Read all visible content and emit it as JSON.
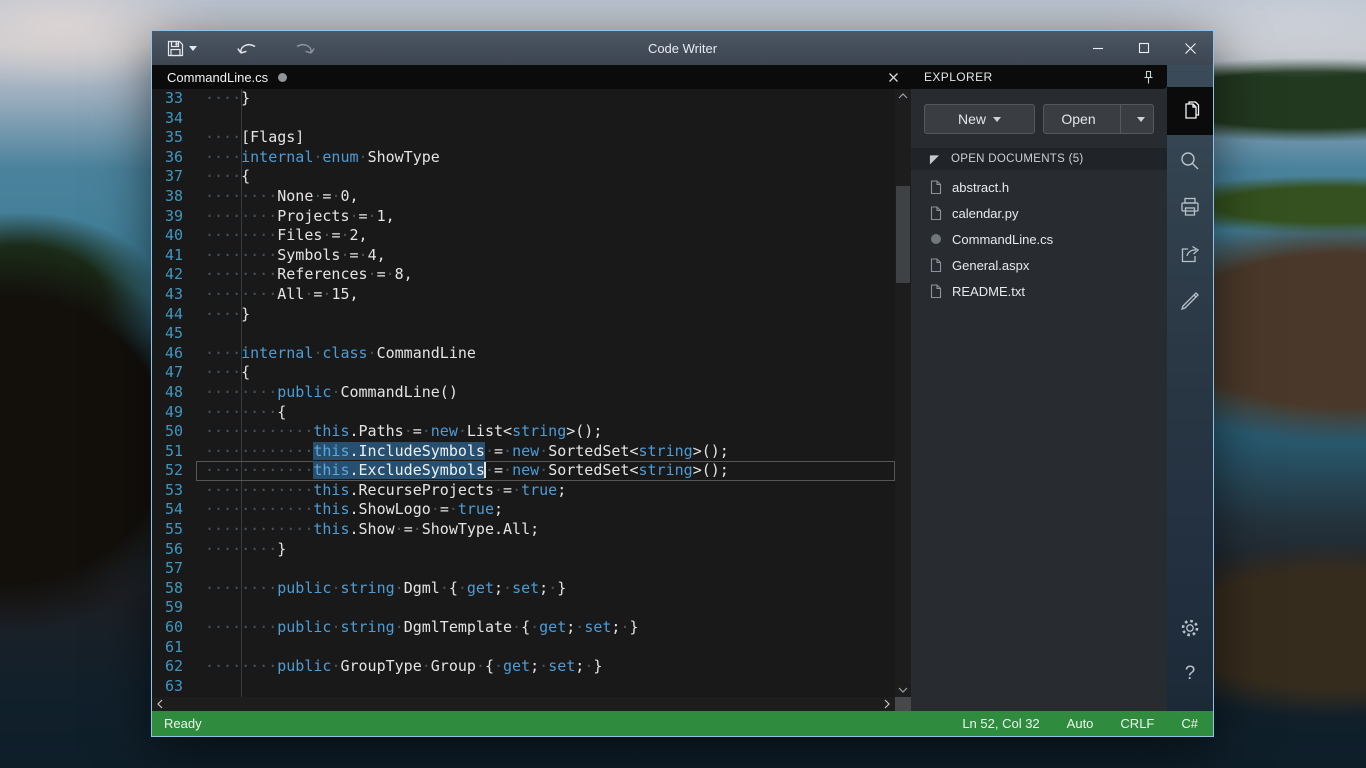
{
  "window": {
    "title": "Code Writer",
    "toolbar": {
      "save_icon": "save-icon",
      "save_dropdown_icon": "chevron-down-icon",
      "undo_icon": "undo-icon",
      "redo_icon": "redo-icon",
      "redo_disabled": true
    },
    "controls": {
      "minimize": "minimize-icon",
      "maximize": "maximize-icon",
      "close": "close-icon"
    }
  },
  "tab": {
    "name": "CommandLine.cs",
    "modified": true
  },
  "editor": {
    "cursor": {
      "line": 52,
      "col": 32
    },
    "highlighted_symbol": "ExcludeSymbols",
    "lines": [
      {
        "n": 33,
        "s": [
          [
            "w",
            "····"
          ],
          [
            "p",
            "}"
          ]
        ]
      },
      {
        "n": 34,
        "s": []
      },
      {
        "n": 35,
        "s": [
          [
            "w",
            "····"
          ],
          [
            "p",
            "[Flags]"
          ]
        ]
      },
      {
        "n": 36,
        "s": [
          [
            "w",
            "····"
          ],
          [
            "k",
            "internal"
          ],
          [
            "w",
            "·"
          ],
          [
            "k",
            "enum"
          ],
          [
            "w",
            "·"
          ],
          [
            "p",
            "ShowType"
          ]
        ]
      },
      {
        "n": 37,
        "s": [
          [
            "w",
            "····"
          ],
          [
            "p",
            "{"
          ]
        ]
      },
      {
        "n": 38,
        "s": [
          [
            "w",
            "········"
          ],
          [
            "p",
            "None"
          ],
          [
            "w",
            "·"
          ],
          [
            "p",
            "="
          ],
          [
            "w",
            "·"
          ],
          [
            "p",
            "0,"
          ]
        ]
      },
      {
        "n": 39,
        "s": [
          [
            "w",
            "········"
          ],
          [
            "p",
            "Projects"
          ],
          [
            "w",
            "·"
          ],
          [
            "p",
            "="
          ],
          [
            "w",
            "·"
          ],
          [
            "p",
            "1,"
          ]
        ]
      },
      {
        "n": 40,
        "s": [
          [
            "w",
            "········"
          ],
          [
            "p",
            "Files"
          ],
          [
            "w",
            "·"
          ],
          [
            "p",
            "="
          ],
          [
            "w",
            "·"
          ],
          [
            "p",
            "2,"
          ]
        ]
      },
      {
        "n": 41,
        "s": [
          [
            "w",
            "········"
          ],
          [
            "p",
            "Symbols"
          ],
          [
            "w",
            "·"
          ],
          [
            "p",
            "="
          ],
          [
            "w",
            "·"
          ],
          [
            "p",
            "4,"
          ]
        ]
      },
      {
        "n": 42,
        "s": [
          [
            "w",
            "········"
          ],
          [
            "p",
            "References"
          ],
          [
            "w",
            "·"
          ],
          [
            "p",
            "="
          ],
          [
            "w",
            "·"
          ],
          [
            "p",
            "8,"
          ]
        ]
      },
      {
        "n": 43,
        "s": [
          [
            "w",
            "········"
          ],
          [
            "p",
            "All"
          ],
          [
            "w",
            "·"
          ],
          [
            "p",
            "="
          ],
          [
            "w",
            "·"
          ],
          [
            "p",
            "15,"
          ]
        ]
      },
      {
        "n": 44,
        "s": [
          [
            "w",
            "····"
          ],
          [
            "p",
            "}"
          ]
        ]
      },
      {
        "n": 45,
        "s": []
      },
      {
        "n": 46,
        "s": [
          [
            "w",
            "····"
          ],
          [
            "k",
            "internal"
          ],
          [
            "w",
            "·"
          ],
          [
            "k",
            "class"
          ],
          [
            "w",
            "·"
          ],
          [
            "p",
            "CommandLine"
          ]
        ]
      },
      {
        "n": 47,
        "s": [
          [
            "w",
            "····"
          ],
          [
            "p",
            "{"
          ]
        ]
      },
      {
        "n": 48,
        "s": [
          [
            "w",
            "········"
          ],
          [
            "k",
            "public"
          ],
          [
            "w",
            "·"
          ],
          [
            "p",
            "CommandLine()"
          ]
        ]
      },
      {
        "n": 49,
        "s": [
          [
            "w",
            "········"
          ],
          [
            "p",
            "{"
          ]
        ]
      },
      {
        "n": 50,
        "s": [
          [
            "w",
            "············"
          ],
          [
            "k",
            "this"
          ],
          [
            "p",
            ".Paths"
          ],
          [
            "w",
            "·"
          ],
          [
            "p",
            "="
          ],
          [
            "w",
            "·"
          ],
          [
            "k",
            "new"
          ],
          [
            "w",
            "·"
          ],
          [
            "p",
            "List<"
          ],
          [
            "k",
            "string"
          ],
          [
            "p",
            ">();"
          ]
        ]
      },
      {
        "n": 51,
        "s": [
          [
            "w",
            "············"
          ],
          [
            "sk",
            "this"
          ],
          [
            "sp",
            ".IncludeSymbols"
          ],
          [
            "w",
            "·"
          ],
          [
            "p",
            "="
          ],
          [
            "w",
            "·"
          ],
          [
            "k",
            "new"
          ],
          [
            "w",
            "·"
          ],
          [
            "p",
            "SortedSet<"
          ],
          [
            "k",
            "string"
          ],
          [
            "p",
            ">();"
          ]
        ]
      },
      {
        "n": 52,
        "cur": true,
        "s": [
          [
            "w",
            "············"
          ],
          [
            "sk",
            "this"
          ],
          [
            "sp",
            ".ExcludeSymbols"
          ],
          [
            "c",
            ""
          ],
          [
            "w",
            "·"
          ],
          [
            "p",
            "="
          ],
          [
            "w",
            "·"
          ],
          [
            "k",
            "new"
          ],
          [
            "w",
            "·"
          ],
          [
            "p",
            "SortedSet<"
          ],
          [
            "k",
            "string"
          ],
          [
            "p",
            ">();"
          ]
        ]
      },
      {
        "n": 53,
        "s": [
          [
            "w",
            "············"
          ],
          [
            "k",
            "this"
          ],
          [
            "p",
            ".RecurseProjects"
          ],
          [
            "w",
            "·"
          ],
          [
            "p",
            "="
          ],
          [
            "w",
            "·"
          ],
          [
            "k",
            "true"
          ],
          [
            "p",
            ";"
          ]
        ]
      },
      {
        "n": 54,
        "s": [
          [
            "w",
            "············"
          ],
          [
            "k",
            "this"
          ],
          [
            "p",
            ".ShowLogo"
          ],
          [
            "w",
            "·"
          ],
          [
            "p",
            "="
          ],
          [
            "w",
            "·"
          ],
          [
            "k",
            "true"
          ],
          [
            "p",
            ";"
          ]
        ]
      },
      {
        "n": 55,
        "s": [
          [
            "w",
            "············"
          ],
          [
            "k",
            "this"
          ],
          [
            "p",
            ".Show"
          ],
          [
            "w",
            "·"
          ],
          [
            "p",
            "="
          ],
          [
            "w",
            "·"
          ],
          [
            "p",
            "ShowType.All;"
          ]
        ]
      },
      {
        "n": 56,
        "s": [
          [
            "w",
            "········"
          ],
          [
            "p",
            "}"
          ]
        ]
      },
      {
        "n": 57,
        "s": []
      },
      {
        "n": 58,
        "s": [
          [
            "w",
            "········"
          ],
          [
            "k",
            "public"
          ],
          [
            "w",
            "·"
          ],
          [
            "k",
            "string"
          ],
          [
            "w",
            "·"
          ],
          [
            "p",
            "Dgml"
          ],
          [
            "w",
            "·"
          ],
          [
            "p",
            "{"
          ],
          [
            "w",
            "·"
          ],
          [
            "k",
            "get"
          ],
          [
            "p",
            ";"
          ],
          [
            "w",
            "·"
          ],
          [
            "k",
            "set"
          ],
          [
            "p",
            ";"
          ],
          [
            "w",
            "·"
          ],
          [
            "p",
            "}"
          ]
        ]
      },
      {
        "n": 59,
        "s": []
      },
      {
        "n": 60,
        "s": [
          [
            "w",
            "········"
          ],
          [
            "k",
            "public"
          ],
          [
            "w",
            "·"
          ],
          [
            "k",
            "string"
          ],
          [
            "w",
            "·"
          ],
          [
            "p",
            "DgmlTemplate"
          ],
          [
            "w",
            "·"
          ],
          [
            "p",
            "{"
          ],
          [
            "w",
            "·"
          ],
          [
            "k",
            "get"
          ],
          [
            "p",
            ";"
          ],
          [
            "w",
            "·"
          ],
          [
            "k",
            "set"
          ],
          [
            "p",
            ";"
          ],
          [
            "w",
            "·"
          ],
          [
            "p",
            "}"
          ]
        ]
      },
      {
        "n": 61,
        "s": []
      },
      {
        "n": 62,
        "s": [
          [
            "w",
            "········"
          ],
          [
            "k",
            "public"
          ],
          [
            "w",
            "·"
          ],
          [
            "p",
            "GroupType"
          ],
          [
            "w",
            "·"
          ],
          [
            "p",
            "Group"
          ],
          [
            "w",
            "·"
          ],
          [
            "p",
            "{"
          ],
          [
            "w",
            "·"
          ],
          [
            "k",
            "get"
          ],
          [
            "p",
            ";"
          ],
          [
            "w",
            "·"
          ],
          [
            "k",
            "set"
          ],
          [
            "p",
            ";"
          ],
          [
            "w",
            "·"
          ],
          [
            "p",
            "}"
          ]
        ]
      },
      {
        "n": 63,
        "s": []
      }
    ]
  },
  "explorer": {
    "title": "EXPLORER",
    "pin_icon": "pin-icon",
    "buttons": {
      "new_label": "New",
      "open_label": "Open"
    },
    "section": "OPEN DOCUMENTS (5)",
    "files": [
      {
        "name": "abstract.h",
        "modified": false
      },
      {
        "name": "calendar.py",
        "modified": false
      },
      {
        "name": "CommandLine.cs",
        "modified": true
      },
      {
        "name": "General.aspx",
        "modified": false
      },
      {
        "name": "README.txt",
        "modified": false
      }
    ]
  },
  "rail": {
    "icons": [
      "documents-icon",
      "search-icon",
      "print-icon",
      "share-icon",
      "edit-icon",
      "settings-icon",
      "help-icon"
    ],
    "active": "documents-icon"
  },
  "statusbar": {
    "ready": "Ready",
    "position": "Ln 52, Col 32",
    "encoding": "Auto",
    "line_ending": "CRLF",
    "language": "C#",
    "color": "#2f8c3e"
  }
}
